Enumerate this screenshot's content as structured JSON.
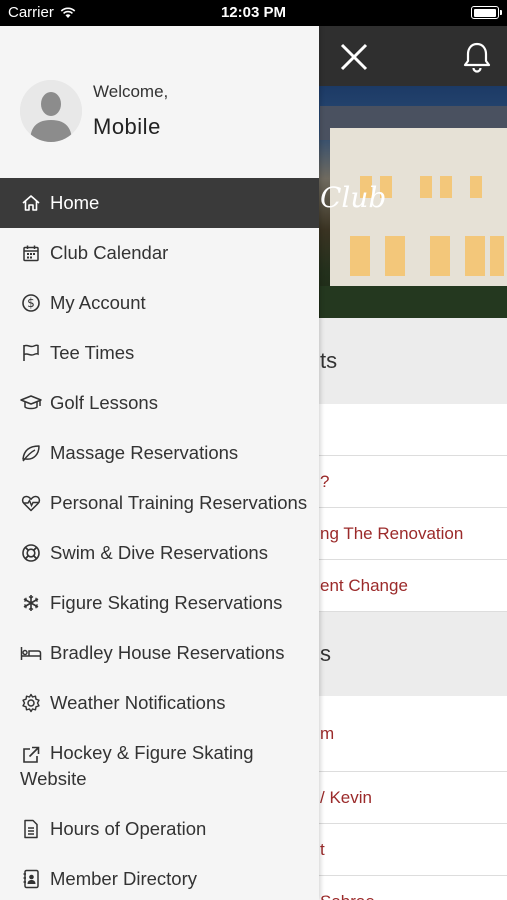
{
  "status_bar": {
    "carrier": "Carrier",
    "time": "12:03 PM",
    "battery_level": 1.0
  },
  "drawer": {
    "welcome": "Welcome,",
    "user_name": "Mobile",
    "items": [
      {
        "label": "Home",
        "icon": "home-icon",
        "active": true
      },
      {
        "label": "Club Calendar",
        "icon": "calendar-icon"
      },
      {
        "label": "My Account",
        "icon": "dollar-icon"
      },
      {
        "label": "Tee Times",
        "icon": "flag-icon"
      },
      {
        "label": "Golf Lessons",
        "icon": "graduation-cap-icon"
      },
      {
        "label": "Massage Reservations",
        "icon": "leaf-icon"
      },
      {
        "label": "Personal Training Reservations",
        "icon": "heartbeat-icon"
      },
      {
        "label": "Swim & Dive Reservations",
        "icon": "lifebuoy-icon"
      },
      {
        "label": "Figure Skating Reservations",
        "icon": "snowflake-icon"
      },
      {
        "label": "Bradley House Reservations",
        "icon": "bed-icon"
      },
      {
        "label": "Weather Notifications",
        "icon": "gear-icon"
      },
      {
        "label": "Hockey & Figure Skating",
        "label_line2": "Website",
        "icon": "external-link-icon"
      },
      {
        "label": "Hours of Operation",
        "icon": "document-icon"
      },
      {
        "label": "Member Directory",
        "icon": "contact-book-icon"
      }
    ]
  },
  "background": {
    "hero_text": "Club",
    "section1_title": "ts",
    "rows1": [
      "",
      "?",
      "ng The Renovation",
      "ent Change"
    ],
    "section2_title": "s",
    "rows2": [
      "m",
      "/ Kevin",
      "t",
      "Sabrae"
    ]
  },
  "colors": {
    "drawer_bg": "#f5f5f5",
    "active_bg": "#3a3a3a",
    "link": "#9b2a2a",
    "topbar": "#2f2f2f"
  }
}
